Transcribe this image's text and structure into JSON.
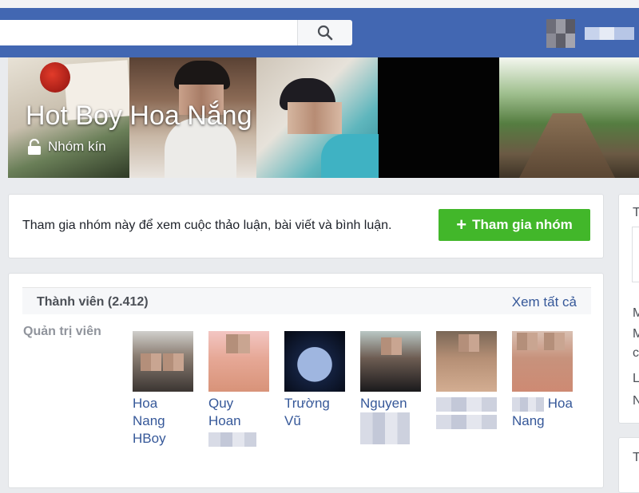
{
  "topbar": {
    "search": {
      "value": "",
      "placeholder": ""
    },
    "brand_color": "#4267b2"
  },
  "cover": {
    "title": "Hot Boy Hoa Nắng",
    "privacy": "Nhóm kín",
    "privacy_icon": "lock-icon"
  },
  "join": {
    "text": "Tham gia nhóm này để xem cuộc thảo luận, bài viết và bình luận.",
    "button_label": "Tham gia nhóm",
    "button_color": "#42b72a"
  },
  "members": {
    "title": "Thành viên (2.412)",
    "see_all": "Xem tất cả",
    "admins_label": "Quản trị viên",
    "admins": [
      {
        "name_line1": "Hoa Nang",
        "name_line2": "HBoy"
      },
      {
        "name_line1": "Quy Hoan",
        "name_line2": ""
      },
      {
        "name_line1": "Trường",
        "name_line2": "Vũ"
      },
      {
        "name_line1": "Nguyen",
        "name_line2": ""
      },
      {
        "name_line1": "",
        "name_line2": ""
      },
      {
        "name_line1": "Hoa",
        "name_line2": "Nang"
      }
    ]
  },
  "right_column": {
    "card1_letters": [
      "T",
      "M",
      "M",
      "c",
      "L",
      "N"
    ],
    "card2_letter": "T"
  }
}
